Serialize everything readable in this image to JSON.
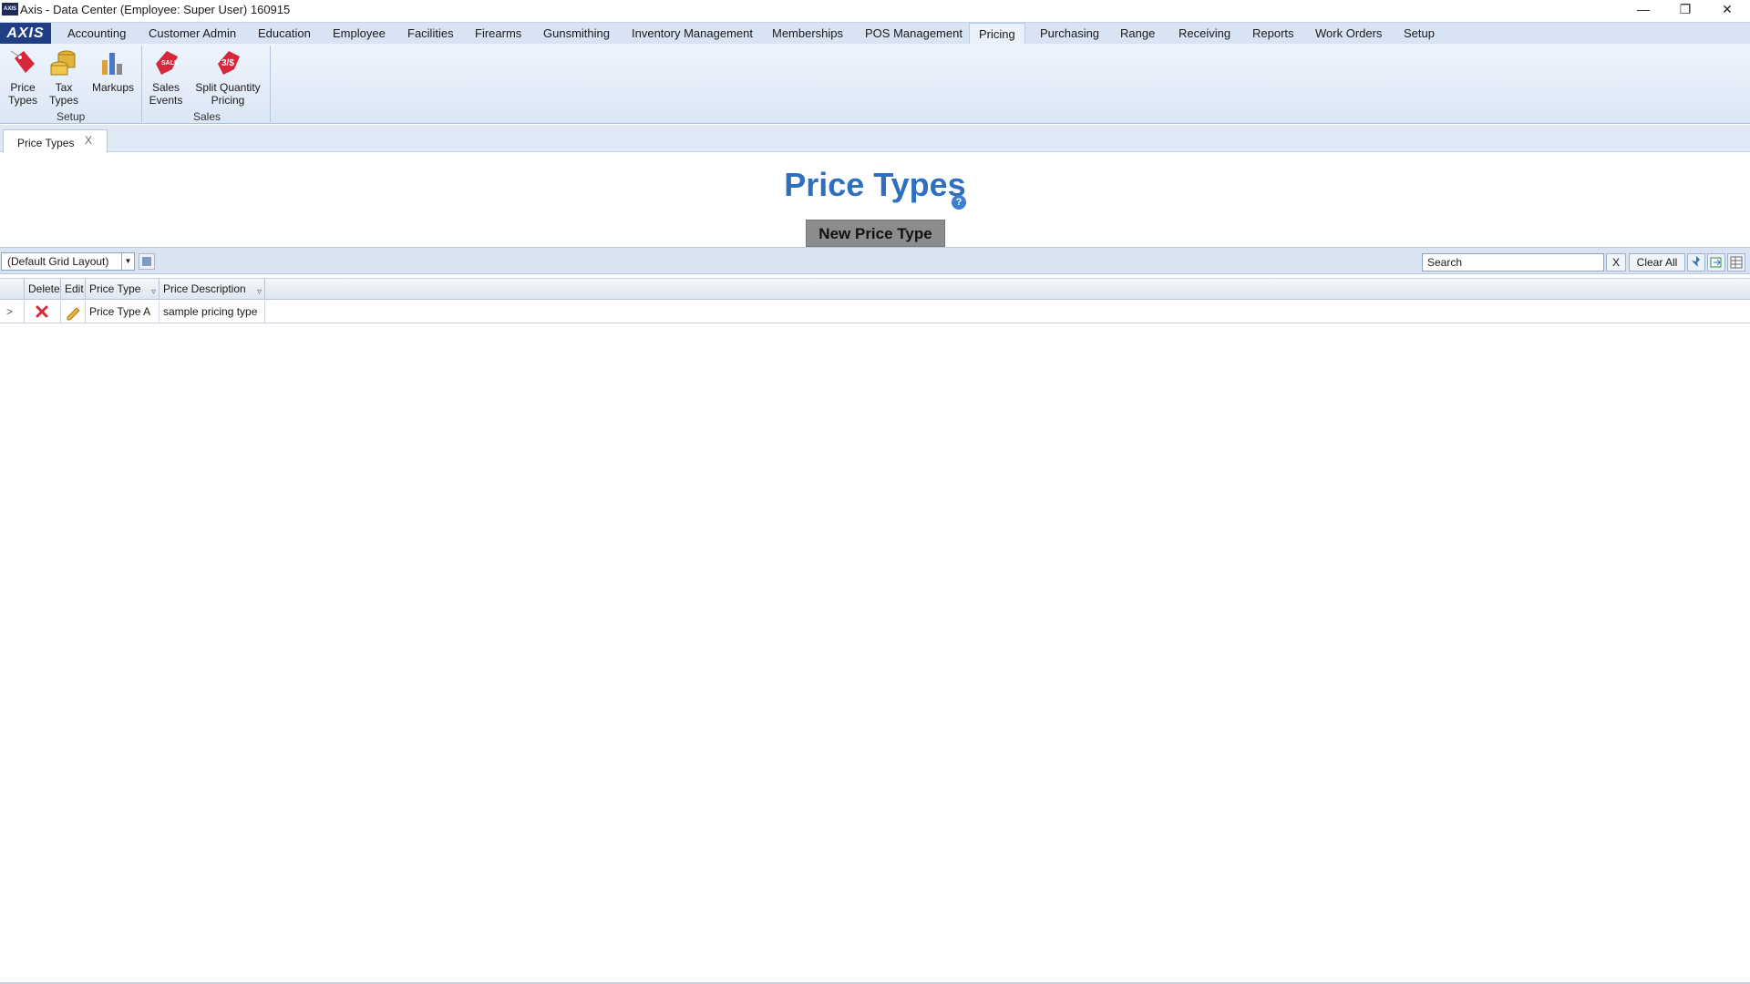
{
  "window": {
    "title": "Axis - Data Center  (Employee: Super User) 160915",
    "app_icon_text": "AXIS",
    "minimize": "—",
    "restore": "❐",
    "close": "✕"
  },
  "menubar": {
    "logo": "AXIS",
    "items": [
      "Accounting",
      "Customer Admin",
      "Education",
      "Employee",
      "Facilities",
      "Firearms",
      "Gunsmithing",
      "Inventory Management",
      "Memberships",
      "POS Management",
      "Pricing",
      "Purchasing",
      "Range",
      "Receiving",
      "Reports",
      "Work Orders",
      "Setup"
    ],
    "active": "Pricing"
  },
  "ribbon": {
    "groups": [
      {
        "label": "Setup",
        "buttons": [
          {
            "line1": "Price",
            "line2": "Types",
            "icon": "price-tag-icon"
          },
          {
            "line1": "Tax",
            "line2": "Types",
            "icon": "coins-icon"
          },
          {
            "line1": "Markups",
            "line2": "",
            "icon": "bar-chart-icon"
          }
        ]
      },
      {
        "label": "Sales",
        "buttons": [
          {
            "line1": "Sales",
            "line2": "Events",
            "icon": "sale-tag-icon"
          },
          {
            "line1": "Split Quantity",
            "line2": "Pricing",
            "icon": "split-tag-icon"
          }
        ]
      }
    ],
    "accent_color": "#d6283a"
  },
  "doc_tabs": [
    {
      "label": "Price Types",
      "close": "X"
    }
  ],
  "page": {
    "title": "Price Types",
    "help": "?",
    "new_button": "New Price Type"
  },
  "grid_toolbar": {
    "layout_value": "(Default Grid Layout)",
    "search_placeholder": "Search",
    "clear_x": "X",
    "clear_all": "Clear All"
  },
  "grid": {
    "columns": [
      "Delete",
      "Edit",
      "Price Type",
      "Price Description"
    ],
    "rows": [
      {
        "expander": ">",
        "price_type": "Price Type A",
        "price_description": "sample pricing type"
      }
    ]
  }
}
